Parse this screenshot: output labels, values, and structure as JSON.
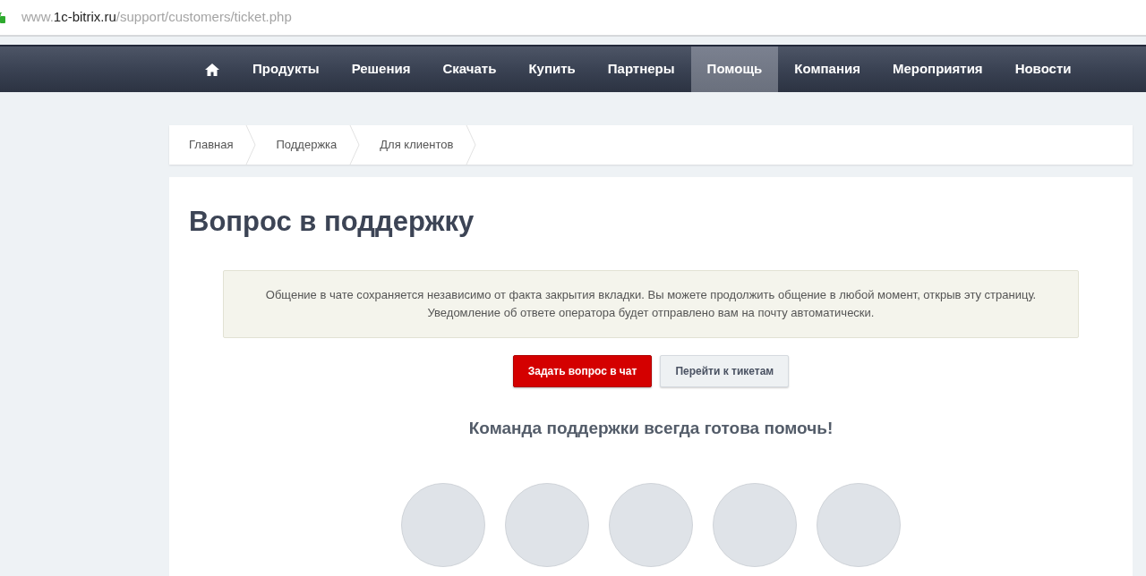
{
  "address_bar": {
    "prefix": "www.",
    "domain": "1c-bitrix.ru",
    "path": "/support/customers/ticket.php"
  },
  "nav": {
    "items": [
      {
        "label": "Продукты",
        "selected": false
      },
      {
        "label": "Решения",
        "selected": false
      },
      {
        "label": "Скачать",
        "selected": false
      },
      {
        "label": "Купить",
        "selected": false
      },
      {
        "label": "Партнеры",
        "selected": false
      },
      {
        "label": "Помощь",
        "selected": true
      },
      {
        "label": "Компания",
        "selected": false
      },
      {
        "label": "Мероприятия",
        "selected": false
      },
      {
        "label": "Новости",
        "selected": false
      }
    ]
  },
  "breadcrumbs": [
    "Главная",
    "Поддержка",
    "Для клиентов"
  ],
  "page_title": "Вопрос в поддержку",
  "notice": [
    "Общение в чате сохраняется независимо от факта закрытия вкладки. Вы можете продолжить общение в любой момент, открыв эту страницу.",
    "Уведомление об ответе оператора будет отправлено вам на почту автоматически."
  ],
  "buttons": [
    {
      "label": "Задать вопрос в чат",
      "kind": "primary"
    },
    {
      "label": "Перейти к тикетам",
      "kind": "secondary"
    }
  ],
  "team": {
    "heading": "Команда поддержки всегда готова помочь!",
    "members": [
      {
        "kind": "photo"
      },
      {
        "kind": "photo"
      },
      {
        "kind": "photo"
      },
      {
        "kind": "photo"
      },
      {
        "kind": "photo"
      }
    ]
  }
}
